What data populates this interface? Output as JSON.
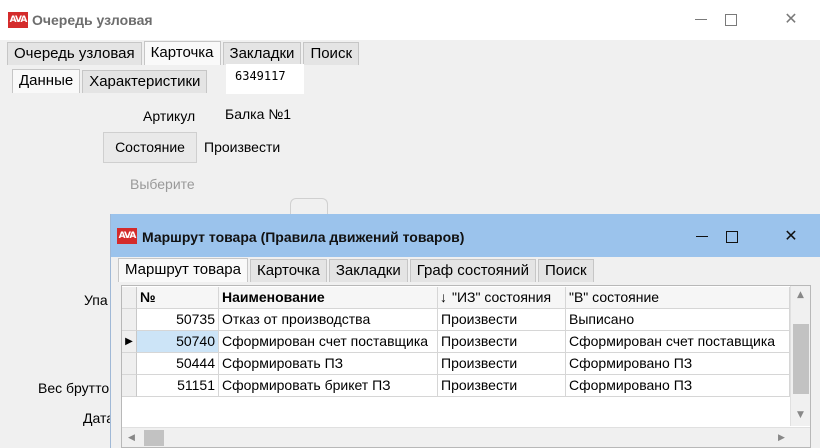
{
  "main_window": {
    "logo_text": "AVA",
    "title": "Очередь узловая",
    "tabs": [
      "Очередь узловая",
      "Карточка",
      "Закладки",
      "Поиск"
    ],
    "subtabs": [
      "Данные",
      "Характеристики"
    ],
    "card_id": "6349117",
    "article_label": "Артикул",
    "article_value": "Балка №1",
    "state_button": "Состояние",
    "state_value": "Произвести",
    "choose_hint": "Выберите",
    "label_packaging": "Упа",
    "label_gross_weight": "Вес брутто",
    "label_date": "Дата"
  },
  "window_controls": {
    "minimize": "—",
    "close": "✕"
  },
  "dialog": {
    "logo_text": "AVA",
    "title": "Маршрут товара (Правила движений товаров)",
    "tabs": [
      "Маршрут товара",
      "Карточка",
      "Закладки",
      "Граф состояний",
      "Поиск"
    ],
    "grid": {
      "headers": {
        "num": "№",
        "name": "Наименование",
        "from": "\"ИЗ\" состояния",
        "to": "\"В\" состояние"
      },
      "sort_arrow": "↓",
      "current_row_marker": "▶",
      "rows": [
        {
          "num": "50735",
          "name": "Отказ от производства",
          "from": "Произвести",
          "to": "Выписано"
        },
        {
          "num": "50740",
          "name": "Сформирован счет поставщика",
          "from": "Произвести",
          "to": "Сформирован счет поставщика"
        },
        {
          "num": "50444",
          "name": "Сформировать ПЗ",
          "from": "Произвести",
          "to": "Сформировано ПЗ"
        },
        {
          "num": "51151",
          "name": "Сформировать брикет ПЗ",
          "from": "Произвести",
          "to": "Сформировано ПЗ"
        }
      ],
      "selected_row": 1
    }
  },
  "colors": {
    "logo_red": "#d42b2b",
    "dialog_title_bg": "#9bc3ec",
    "selection": "#cce4f7"
  }
}
